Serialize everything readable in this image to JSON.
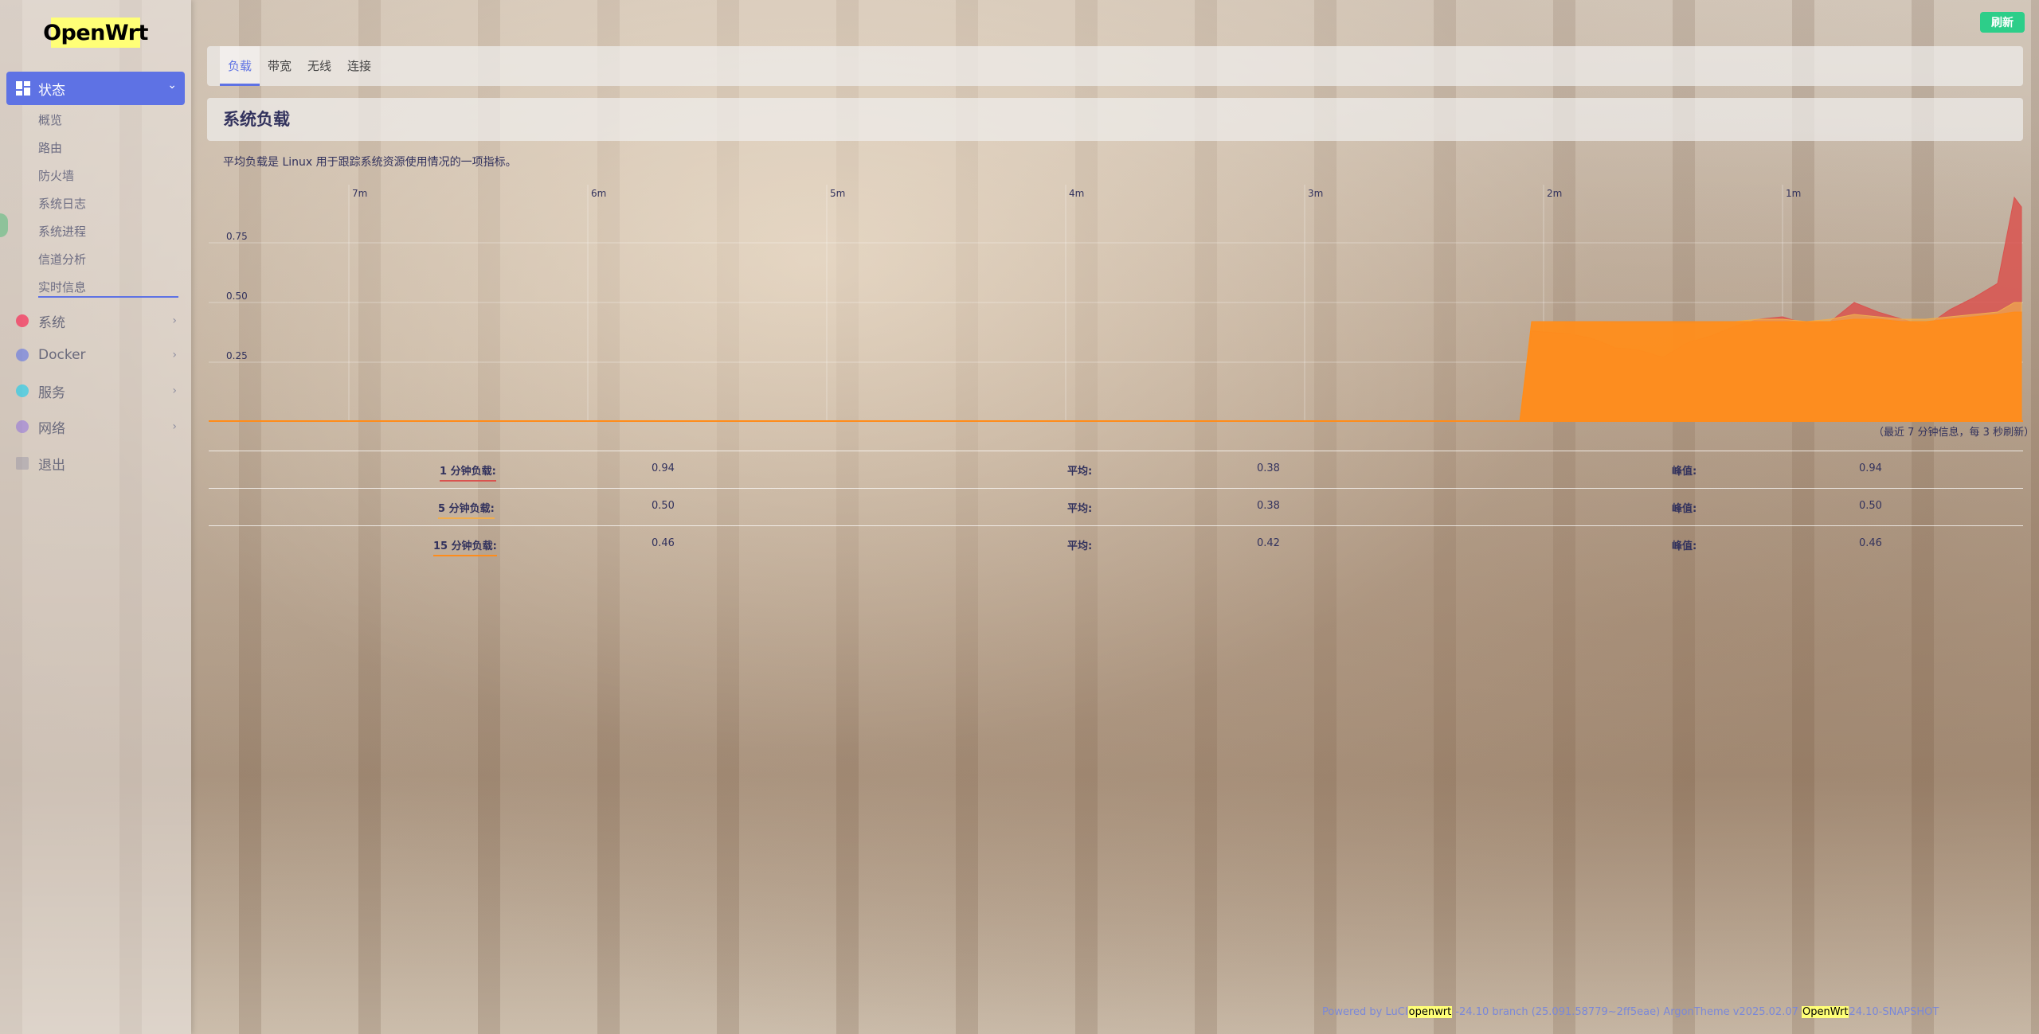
{
  "sidebar": {
    "logo": "OpenWrt",
    "active_section": "状态",
    "status_items": [
      "概览",
      "路由",
      "防火墙",
      "系统日志",
      "系统进程",
      "信道分析",
      "实时信息"
    ],
    "sections": [
      {
        "label": "系统",
        "color": "#f5365c"
      },
      {
        "label": "Docker",
        "color": "#5e72e4"
      },
      {
        "label": "服务",
        "color": "#11cdef"
      },
      {
        "label": "网络",
        "color": "#8965e0"
      },
      {
        "label": "退出",
        "color": "#8d8da0"
      }
    ]
  },
  "header": {
    "refresh_label": "刷新",
    "tabs": [
      "负载",
      "带宽",
      "无线",
      "连接"
    ],
    "active_tab": "负载"
  },
  "main": {
    "title": "系统负载",
    "description": "平均负载是 Linux 用于跟踪系统资源使用情况的一项指标。",
    "chart_note": "（最近 7 分钟信息，每 3 秒刷新）"
  },
  "chart_data": {
    "type": "area",
    "x_tick_labels": [
      "7m",
      "6m",
      "5m",
      "4m",
      "3m",
      "2m",
      "1m"
    ],
    "y_tick_labels": [
      "0.75",
      "0.50",
      "0.25"
    ],
    "ylim": [
      0,
      0.94
    ],
    "x_minutes_ago": [
      7.5,
      2.1,
      2.05,
      1.9,
      1.8,
      1.7,
      1.6,
      1.5,
      1.4,
      1.3,
      1.2,
      1.1,
      1.0,
      0.9,
      0.8,
      0.7,
      0.6,
      0.5,
      0.4,
      0.3,
      0.2,
      0.1,
      0.03,
      0
    ],
    "series": [
      {
        "name": "1 分钟负载",
        "color": "#d9534f",
        "values": [
          0,
          0,
          0.38,
          0.37,
          0.35,
          0.31,
          0.3,
          0.27,
          0.33,
          0.36,
          0.4,
          0.43,
          0.44,
          0.41,
          0.42,
          0.5,
          0.46,
          0.43,
          0.4,
          0.47,
          0.52,
          0.58,
          0.94,
          0.9
        ]
      },
      {
        "name": "5 分钟负载",
        "color": "#f0ad4e",
        "values": [
          0,
          0,
          0.42,
          0.42,
          0.42,
          0.41,
          0.41,
          0.41,
          0.41,
          0.41,
          0.42,
          0.43,
          0.43,
          0.42,
          0.43,
          0.45,
          0.44,
          0.43,
          0.43,
          0.44,
          0.45,
          0.46,
          0.5,
          0.5
        ]
      },
      {
        "name": "15 分钟负载",
        "color": "#ff8c1a",
        "values": [
          0,
          0,
          0.42,
          0.42,
          0.42,
          0.42,
          0.42,
          0.42,
          0.42,
          0.42,
          0.42,
          0.42,
          0.42,
          0.42,
          0.42,
          0.43,
          0.43,
          0.42,
          0.42,
          0.43,
          0.44,
          0.45,
          0.46,
          0.46
        ]
      }
    ]
  },
  "stats": {
    "avg_label": "平均:",
    "peak_label": "峰值:",
    "rows": [
      {
        "label": "1 分钟负载:",
        "color": "#d9534f",
        "current": "0.94",
        "avg": "0.38",
        "peak": "0.94"
      },
      {
        "label": "5 分钟负载:",
        "color": "#f0ad4e",
        "current": "0.50",
        "avg": "0.38",
        "peak": "0.50"
      },
      {
        "label": "15 分钟负载:",
        "color": "#ff8c1a",
        "current": "0.46",
        "avg": "0.42",
        "peak": "0.46"
      }
    ]
  },
  "footer": {
    "powered": "Powered by LuCI",
    "brand1": "openwrt",
    "branch": "-24.10 branch (25.091.58779~2ff5eae)",
    "theme": "ArgonTheme v2025.02.07",
    "brand2": "OpenWrt",
    "version": "24.10-SNAPSHOT"
  }
}
